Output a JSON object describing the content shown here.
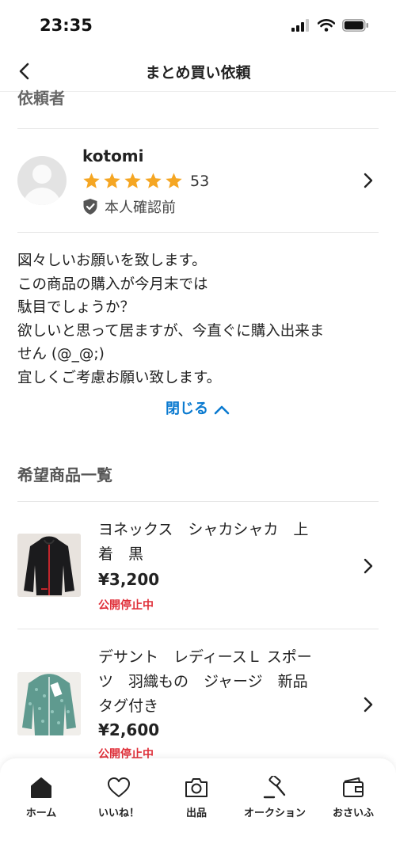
{
  "status_bar": {
    "time": "23:35"
  },
  "nav": {
    "title": "まとめ買い依頼"
  },
  "requester_section": {
    "title": "依頼者"
  },
  "requester": {
    "name": "kotomi",
    "rating_stars": 5,
    "rating_count": "53",
    "verification": "本人確認前"
  },
  "message": {
    "text": "図々しいお願いを致します。\nこの商品の購入が今月末では\n駄目でしょうか？\n欲しいと思って居ますが、今直ぐに購入出来ま\nせん (@_@;)\n宜しくご考慮お願い致します。",
    "close_label": "閉じる"
  },
  "items_section": {
    "title": "希望商品一覧"
  },
  "items": [
    {
      "name": "ヨネックス　シャカシャカ　上\n着　黒",
      "price": "¥3,200",
      "status": "公開停止中"
    },
    {
      "name": "デサント　レディースＬ スポー\nツ　羽織もの　ジャージ　新品\nタグ付き",
      "price": "¥2,600",
      "status": "公開停止中"
    }
  ],
  "tabbar": {
    "tabs": [
      {
        "label": "ホーム",
        "icon": "home-icon"
      },
      {
        "label": "いいね！",
        "icon": "heart-icon"
      },
      {
        "label": "出品",
        "icon": "camera-icon"
      },
      {
        "label": "オークション",
        "icon": "gavel-icon"
      },
      {
        "label": "おさいふ",
        "icon": "wallet-icon"
      }
    ]
  },
  "colors": {
    "accent": "#0a7ad0",
    "star": "#f5a623",
    "status_red": "#e0303a"
  }
}
